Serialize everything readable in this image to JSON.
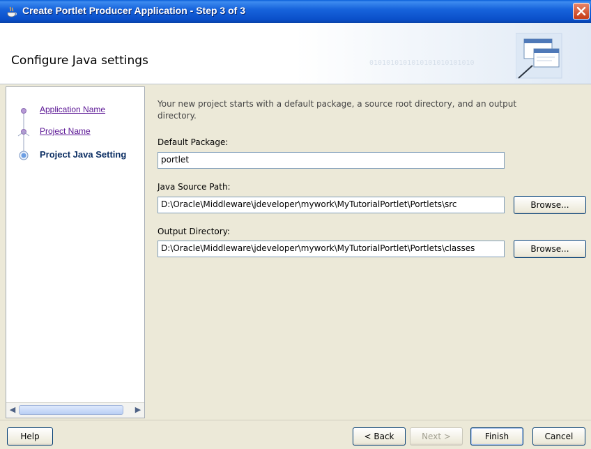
{
  "window": {
    "title": "Create Portlet Producer Application - Step 3 of 3",
    "close_icon": "close-icon"
  },
  "header": {
    "title": "Configure Java settings",
    "binary_decoration": "0101010101010101010101010",
    "graphic_icon": "wizard-windows-icon"
  },
  "nav": {
    "items": [
      {
        "label": "Application Name",
        "state": "visited"
      },
      {
        "label": "Project Name",
        "state": "visited"
      },
      {
        "label": "Project Java Setting",
        "state": "current"
      }
    ],
    "scroll_left_icon": "scroll-left-icon",
    "scroll_right_icon": "scroll-right-icon"
  },
  "content": {
    "intro": "Your new project starts with a default package, a source root directory, and an output directory.",
    "default_package": {
      "label": "Default Package:",
      "value": "portlet"
    },
    "java_source_path": {
      "label": "Java Source Path:",
      "value": "D:\\Oracle\\Middleware\\jdeveloper\\mywork\\MyTutorialPortlet\\Portlets\\src",
      "browse": "Browse..."
    },
    "output_directory": {
      "label": "Output Directory:",
      "value": "D:\\Oracle\\Middleware\\jdeveloper\\mywork\\MyTutorialPortlet\\Portlets\\classes",
      "browse": "Browse..."
    }
  },
  "footer": {
    "help": "Help",
    "back": "< Back",
    "next": "Next >",
    "finish": "Finish",
    "cancel": "Cancel"
  },
  "colors": {
    "titlebar": "#0a4fc9",
    "link_visited": "#5a1494",
    "current_step": "#0b2e63"
  }
}
